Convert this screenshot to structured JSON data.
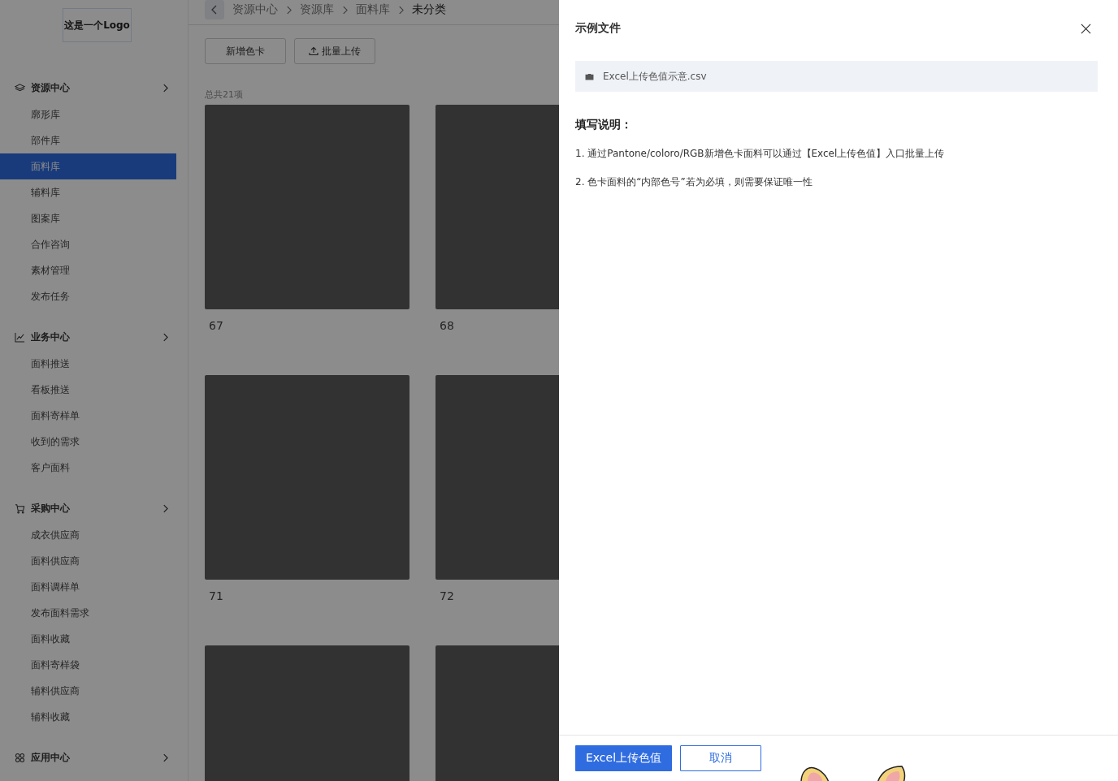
{
  "logo": "这是一个Logo",
  "sidebar": {
    "groups": [
      {
        "title": "资源中心",
        "items": [
          {
            "label": "廓形库",
            "selected": false
          },
          {
            "label": "部件库",
            "selected": false
          },
          {
            "label": "面料库",
            "selected": true
          },
          {
            "label": "辅料库",
            "selected": false
          },
          {
            "label": "图案库",
            "selected": false
          },
          {
            "label": "合作咨询",
            "selected": false
          },
          {
            "label": "素材管理",
            "selected": false
          },
          {
            "label": "发布任务",
            "selected": false
          }
        ]
      },
      {
        "title": "业务中心",
        "items": [
          {
            "label": "面料推送",
            "selected": false
          },
          {
            "label": "看板推送",
            "selected": false
          },
          {
            "label": "面料寄样单",
            "selected": false
          },
          {
            "label": "收到的需求",
            "selected": false
          },
          {
            "label": "客户面料",
            "selected": false
          }
        ]
      },
      {
        "title": "采购中心",
        "items": [
          {
            "label": "成衣供应商",
            "selected": false
          },
          {
            "label": "面料供应商",
            "selected": false
          },
          {
            "label": "面料调样单",
            "selected": false
          },
          {
            "label": "发布面料需求",
            "selected": false
          },
          {
            "label": "面料收藏",
            "selected": false
          },
          {
            "label": "面料寄样袋",
            "selected": false
          },
          {
            "label": "辅料供应商",
            "selected": false
          },
          {
            "label": "辅料收藏",
            "selected": false
          }
        ]
      },
      {
        "title": "应用中心"
      }
    ]
  },
  "breadcrumb": [
    "资源中心",
    "资源库",
    "面料库",
    "未分类"
  ],
  "toolbar": [
    {
      "label": "新增色卡",
      "kind": "plain"
    },
    {
      "label": "批量上传",
      "kind": "upload"
    }
  ],
  "total": "总共21项",
  "cards": [
    {
      "kind": "swatch",
      "label": "67"
    },
    {
      "kind": "swatch",
      "label": "68"
    },
    {
      "kind": "swatch",
      "label": "71"
    },
    {
      "kind": "swatch",
      "label": "72"
    },
    {
      "kind": "swatch"
    },
    {
      "kind": "swatch"
    }
  ],
  "drawer": {
    "title": "示例文件",
    "file": "Excel上传色值示意.csv",
    "heading": "填写说明：",
    "notes": [
      "1. 通过Pantone/coloro/RGB新增色卡面料可以通过【Excel上传色值】入口批量上传",
      "2. 色卡面料的“内部色号”若为必填，则需要保证唯一性"
    ],
    "buttons": [
      {
        "label": "Excel上传色值",
        "kind": "primary"
      },
      {
        "label": "取消",
        "kind": "secondary"
      }
    ]
  }
}
